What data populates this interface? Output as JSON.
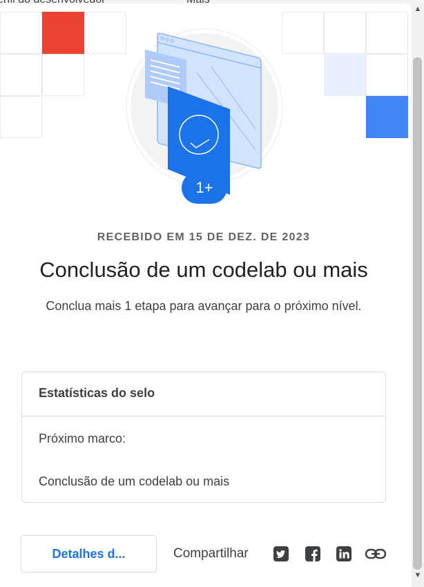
{
  "background_tab_strip": {
    "left_text": "erfil do desenvolvedor",
    "more_menu": "Mais"
  },
  "badge": {
    "count_label": "1+",
    "icon": "codelab-badge-illustration",
    "accent_color": "#1a73e8"
  },
  "received_text": "RECEBIDO EM 15 DE DEZ. DE 2023",
  "title": "Conclusão de um codelab ou mais",
  "subtitle": "Conclua mais 1 etapa para avançar para o próximo nível.",
  "stats": {
    "header": "Estatísticas do selo",
    "next_milestone_label": "Próximo marco:",
    "next_milestone_value": "Conclusão de um codelab ou mais"
  },
  "actions": {
    "details_button": "Detalhes d...",
    "share_label": "Compartilhar",
    "share_icons": [
      "twitter-icon",
      "facebook-icon",
      "linkedin-icon",
      "link-icon"
    ]
  },
  "decor_colors": {
    "red": "#ea4335",
    "blue": "#4285f4",
    "light_blue": "#e8f0fe"
  }
}
